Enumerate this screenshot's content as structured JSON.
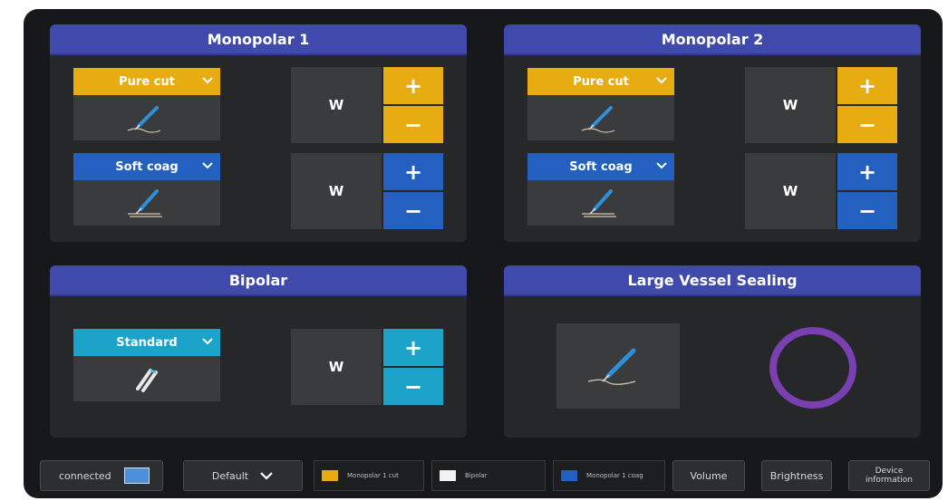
{
  "monopolar1": {
    "title": "Monopolar 1",
    "cut_mode": "Pure cut",
    "coag_mode": "Soft coag",
    "unit": "W",
    "plus": "+",
    "minus": "−"
  },
  "monopolar2": {
    "title": "Monopolar 2",
    "cut_mode": "Pure cut",
    "coag_mode": "Soft coag",
    "unit": "W",
    "plus": "+",
    "minus": "−"
  },
  "bipolar": {
    "title": "Bipolar",
    "mode": "Standard",
    "unit": "W",
    "plus": "+",
    "minus": "−"
  },
  "vessel_sealing": {
    "title": "Large Vessel Sealing"
  },
  "bottom": {
    "connected": "connected",
    "profile": "Default",
    "legend_cut": "Monopolar 1 cut",
    "legend_bipolar": "Bipolar",
    "legend_coag": "Monopolar 1 coag",
    "volume": "Volume",
    "brightness": "Brightness",
    "device_info": "Device information"
  },
  "colors": {
    "header": "#3f4aac",
    "cut": "#e6ac12",
    "coag": "#2360c0",
    "bipolar": "#1ba3c9",
    "ring": "#7a3fb0"
  }
}
